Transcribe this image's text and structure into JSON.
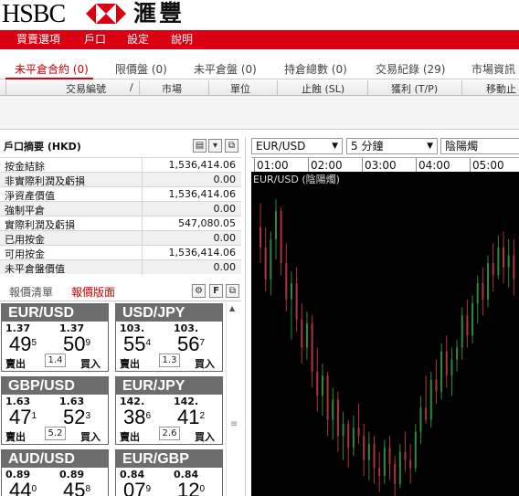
{
  "header": {
    "brand": "HSBC",
    "brand_cn": "滙豐",
    "colors": {
      "brand_red": "#db0011",
      "tile_header": "#6d6d6d",
      "chart_bg": "#000000",
      "candle_up": "#2e8b3e",
      "candle_down": "#b1343c"
    }
  },
  "menu": [
    "買賣選項",
    "戶口",
    "設定",
    "說明"
  ],
  "tabs": [
    {
      "label": "未平倉合約 (0)",
      "active": true
    },
    {
      "label": "限價盤 (0)"
    },
    {
      "label": "未平倉盤 (0)"
    },
    {
      "label": "持倉總數 (0)"
    },
    {
      "label": "交易紀錄 (29)"
    },
    {
      "label": "市場資訊"
    }
  ],
  "columns": [
    "交易編號",
    "/",
    "市場",
    "單位",
    "止蝕 (SL)",
    "獲利 (T/P)",
    "移動止"
  ],
  "account": {
    "title": "戶口摘要 (HKD)",
    "rows": [
      {
        "label": "按金結餘",
        "value": "1,536,414.06"
      },
      {
        "label": "非實際利潤及虧損",
        "value": "0.00"
      },
      {
        "label": "淨資產價值",
        "value": "1,536,414.06"
      },
      {
        "label": "強制平倉",
        "value": "0.00"
      },
      {
        "label": "實際利潤及虧損",
        "value": "547,080.05"
      },
      {
        "label": "已用按金",
        "value": "0.00"
      },
      {
        "label": "可用按金",
        "value": "1,536,414.06"
      },
      {
        "label": "未平倉盤價值",
        "value": "0.00"
      }
    ]
  },
  "quote_tabs": [
    {
      "label": "報價清單"
    },
    {
      "label": "報價版面",
      "active": true
    }
  ],
  "quotes": [
    {
      "pair": "EUR/USD",
      "sell_prefix": "1.37",
      "sell_big": "49",
      "sell_sup": "5",
      "buy_prefix": "1.37",
      "buy_big": "50",
      "buy_sup": "9",
      "spread": "1.4",
      "sell_label": "賣出",
      "buy_label": "買入"
    },
    {
      "pair": "USD/JPY",
      "sell_prefix": "103.",
      "sell_big": "55",
      "sell_sup": "4",
      "buy_prefix": "103.",
      "buy_big": "56",
      "buy_sup": "7",
      "spread": "1.3",
      "sell_label": "賣出",
      "buy_label": "買入"
    },
    {
      "pair": "GBP/USD",
      "sell_prefix": "1.63",
      "sell_big": "47",
      "sell_sup": "1",
      "buy_prefix": "1.63",
      "buy_big": "52",
      "buy_sup": "3",
      "spread": "5.2",
      "sell_label": "賣出",
      "buy_label": "買入"
    },
    {
      "pair": "EUR/JPY",
      "sell_prefix": "142.",
      "sell_big": "38",
      "sell_sup": "6",
      "buy_prefix": "142.",
      "buy_big": "41",
      "buy_sup": "2",
      "spread": "2.6",
      "sell_label": "賣出",
      "buy_label": "買入"
    },
    {
      "pair": "AUD/USD",
      "sell_prefix": "0.89",
      "sell_big": "44",
      "sell_sup": "0",
      "buy_prefix": "0.89",
      "buy_big": "45",
      "buy_sup": "8",
      "spread": "",
      "sell_label": "",
      "buy_label": ""
    },
    {
      "pair": "EUR/GBP",
      "sell_prefix": "0.84",
      "sell_big": "07",
      "sell_sup": "9",
      "buy_prefix": "0.84",
      "buy_big": "12",
      "buy_sup": "0",
      "spread": "",
      "sell_label": "",
      "buy_label": ""
    }
  ],
  "chart": {
    "symbol_select": "EUR/USD",
    "interval_select": "5 分鐘",
    "style_select": "陰陽燭",
    "title": "EUR/USD (陰陽燭)",
    "time_labels": [
      "01:00",
      "02:00",
      "03:00",
      "04:00",
      "05:00"
    ],
    "candles": [
      [
        1.3752,
        1.3758,
        1.3743,
        1.3747
      ],
      [
        1.3747,
        1.3752,
        1.3736,
        1.3739
      ],
      [
        1.3739,
        1.3751,
        1.3735,
        1.3749
      ],
      [
        1.3749,
        1.3759,
        1.3744,
        1.3756
      ],
      [
        1.3756,
        1.3757,
        1.374,
        1.3743
      ],
      [
        1.3743,
        1.3748,
        1.3731,
        1.3734
      ],
      [
        1.3734,
        1.3741,
        1.3724,
        1.3738
      ],
      [
        1.3738,
        1.3742,
        1.3726,
        1.3729
      ],
      [
        1.3729,
        1.3733,
        1.3718,
        1.3722
      ],
      [
        1.3722,
        1.3731,
        1.3719,
        1.3728
      ],
      [
        1.3728,
        1.373,
        1.3712,
        1.3716
      ],
      [
        1.3716,
        1.3722,
        1.3706,
        1.371
      ],
      [
        1.371,
        1.3718,
        1.3705,
        1.3715
      ],
      [
        1.3715,
        1.3716,
        1.37,
        1.3704
      ],
      [
        1.3704,
        1.3712,
        1.3699,
        1.3709
      ],
      [
        1.3709,
        1.3711,
        1.3696,
        1.37
      ],
      [
        1.37,
        1.3706,
        1.3694,
        1.3703
      ],
      [
        1.3703,
        1.3704,
        1.3692,
        1.3697
      ],
      [
        1.3697,
        1.3705,
        1.3695,
        1.3702
      ],
      [
        1.3702,
        1.3708,
        1.3698,
        1.37
      ],
      [
        1.37,
        1.3703,
        1.369,
        1.3694
      ],
      [
        1.3694,
        1.3701,
        1.3689,
        1.3698
      ],
      [
        1.3698,
        1.37,
        1.3688,
        1.3692
      ],
      [
        1.3692,
        1.3696,
        1.3686,
        1.369
      ],
      [
        1.369,
        1.3699,
        1.3688,
        1.3697
      ],
      [
        1.3697,
        1.37,
        1.3689,
        1.3693
      ],
      [
        1.3693,
        1.3695,
        1.3685,
        1.3688
      ],
      [
        1.3688,
        1.3698,
        1.3687,
        1.3696
      ],
      [
        1.3696,
        1.3701,
        1.3691,
        1.3694
      ],
      [
        1.3694,
        1.3698,
        1.3688,
        1.3692
      ],
      [
        1.3692,
        1.3703,
        1.3691,
        1.3701
      ],
      [
        1.3701,
        1.371,
        1.3698,
        1.3707
      ],
      [
        1.3707,
        1.3715,
        1.3703,
        1.3704
      ],
      [
        1.3704,
        1.3716,
        1.3702,
        1.3714
      ],
      [
        1.3714,
        1.3719,
        1.3708,
        1.3711
      ],
      [
        1.3711,
        1.3723,
        1.3709,
        1.3721
      ],
      [
        1.3721,
        1.3725,
        1.3712,
        1.3715
      ],
      [
        1.3715,
        1.3722,
        1.371,
        1.3719
      ],
      [
        1.3719,
        1.3724,
        1.3716,
        1.3722
      ],
      [
        1.3722,
        1.3732,
        1.3719,
        1.373
      ],
      [
        1.373,
        1.3734,
        1.3722,
        1.3725
      ],
      [
        1.3725,
        1.3735,
        1.3723,
        1.3733
      ],
      [
        1.3733,
        1.374,
        1.3728,
        1.3738
      ],
      [
        1.3738,
        1.3742,
        1.373,
        1.3734
      ],
      [
        1.3734,
        1.3745,
        1.3732,
        1.3743
      ],
      [
        1.3743,
        1.3748,
        1.3736,
        1.374
      ],
      [
        1.374,
        1.375,
        1.3739,
        1.3747
      ],
      [
        1.3747,
        1.3751,
        1.3738,
        1.3742
      ],
      [
        1.3742,
        1.3749,
        1.3737,
        1.3745
      ],
      [
        1.3745,
        1.3749,
        1.3735,
        1.3739
      ]
    ]
  }
}
